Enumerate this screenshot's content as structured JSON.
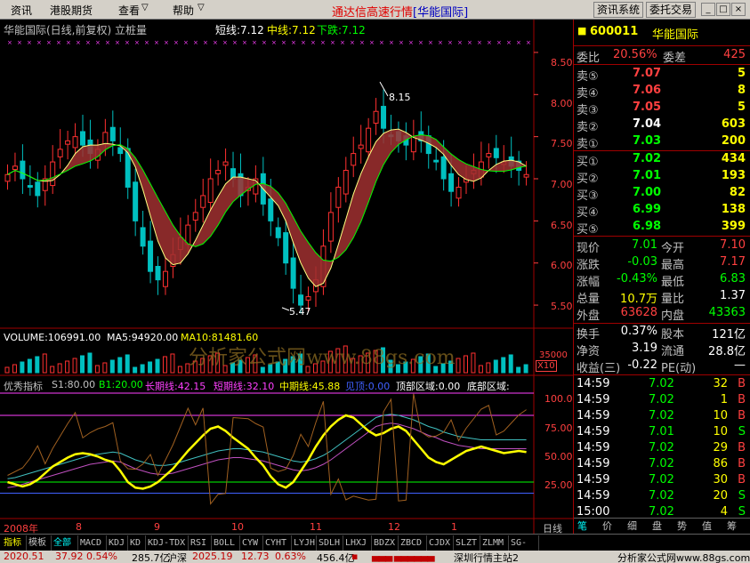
{
  "menu": {
    "items": [
      "资讯",
      "港股期货",
      "查看",
      "帮助"
    ],
    "title_main": "通达信高速行情",
    "title_sub": "[华能国际]",
    "btn_info": "资讯系统",
    "btn_trade": "委托交易",
    "win_min": "_",
    "win_max": "□",
    "win_close": "×"
  },
  "chart": {
    "header": {
      "name": "华能国际(日线,前复权)",
      "indicator": "立桩量",
      "short": "短线:7.12",
      "mid": "中线:7.12",
      "down": "下跌:7.12"
    },
    "price_ticks": [
      "8.50",
      "8.00",
      "7.50",
      "7.00",
      "6.50",
      "6.00",
      "5.50"
    ],
    "high_label": "8.15",
    "low_label": "5.47",
    "volume_header": {
      "volume": "VOLUME:106991.00",
      "ma5": "MA5:94920.00",
      "ma10": "MA10:81481.60"
    },
    "vol_tick": "35000",
    "vol_unit": "X10",
    "watermark": "分析家公式网www.88gs.com",
    "indicator_header": {
      "name": "优秀指标",
      "s1": "S1:80.00",
      "b1": "B1:20.00",
      "long": "长期线:42.15",
      "short": "短期线:32.10",
      "mid": "中期线:45.88",
      "trend": "见顶:0.00",
      "top": "顶部区域:0.00",
      "bottom": "底部区域:"
    },
    "ind_ticks": [
      "100.0",
      "75.00",
      "50.00",
      "25.00"
    ],
    "months": [
      "2008年",
      "8",
      "9",
      "10",
      "11",
      "12",
      "1"
    ],
    "period": "日线"
  },
  "chart_data": {
    "type": "candlestick",
    "title": "华能国际(日线,前复权)",
    "ylim": [
      5.3,
      8.7
    ],
    "high": 8.15,
    "low": 5.47,
    "close_series": [
      7.05,
      7.15,
      7.0,
      6.9,
      6.8,
      7.0,
      7.2,
      7.35,
      7.45,
      7.5,
      7.4,
      7.3,
      7.35,
      7.55,
      7.45,
      7.3,
      6.9,
      6.5,
      6.2,
      5.9,
      5.8,
      5.9,
      6.1,
      6.3,
      6.45,
      6.6,
      6.8,
      7.0,
      7.1,
      7.2,
      7.0,
      6.8,
      6.9,
      7.0,
      6.7,
      6.5,
      6.3,
      6.0,
      5.7,
      5.5,
      5.6,
      5.8,
      6.2,
      6.6,
      6.9,
      7.1,
      7.3,
      7.4,
      7.6,
      7.8,
      7.6,
      7.5,
      7.45,
      7.4,
      7.5,
      7.45,
      7.3,
      7.2,
      7.0,
      6.85,
      6.9,
      7.0,
      7.1,
      7.2,
      7.3,
      7.25,
      7.2,
      7.15,
      7.1,
      7.05
    ],
    "ind_series": {
      "long": [
        15,
        16,
        18,
        20,
        22,
        24,
        26,
        28,
        30,
        32,
        34,
        36,
        37,
        38,
        39,
        38,
        35,
        32,
        30,
        28,
        27,
        27,
        28,
        30,
        32,
        34,
        36,
        38,
        40,
        41,
        42,
        42,
        41,
        40,
        39,
        37,
        35,
        33,
        31,
        30,
        31,
        33,
        36,
        40,
        45,
        50,
        55,
        60,
        65,
        70,
        72,
        73,
        72,
        70,
        68,
        65,
        62,
        60,
        57,
        55,
        53,
        52,
        51,
        50,
        50,
        50,
        50,
        50,
        50,
        50
      ],
      "short": [
        20,
        18,
        16,
        18,
        22,
        28,
        34,
        38,
        42,
        45,
        46,
        45,
        43,
        40,
        38,
        30,
        20,
        15,
        14,
        16,
        20,
        26,
        32,
        40,
        48,
        55,
        62,
        68,
        70,
        66,
        60,
        55,
        50,
        42,
        35,
        25,
        18,
        15,
        20,
        30,
        40,
        52,
        62,
        70,
        76,
        80,
        78,
        72,
        66,
        62,
        64,
        68,
        70,
        66,
        58,
        50,
        42,
        38,
        36,
        40,
        44,
        48,
        50,
        52,
        50,
        48,
        46,
        47,
        48,
        47
      ]
    }
  },
  "panel": {
    "code": "600011",
    "name": "华能国际",
    "webi_label": "委比",
    "webi_val": "20.56%",
    "wecha_label": "委差",
    "wecha_val": "425",
    "sells": [
      {
        "label": "卖⑤",
        "price": "7.07",
        "vol": "5"
      },
      {
        "label": "卖④",
        "price": "7.06",
        "vol": "8"
      },
      {
        "label": "卖③",
        "price": "7.05",
        "vol": "5"
      },
      {
        "label": "卖②",
        "price": "7.04",
        "vol": "603"
      },
      {
        "label": "卖①",
        "price": "7.03",
        "vol": "200"
      }
    ],
    "buys": [
      {
        "label": "买①",
        "price": "7.02",
        "vol": "434"
      },
      {
        "label": "买②",
        "price": "7.01",
        "vol": "193"
      },
      {
        "label": "买③",
        "price": "7.00",
        "vol": "82"
      },
      {
        "label": "买④",
        "price": "6.99",
        "vol": "138"
      },
      {
        "label": "买⑤",
        "price": "6.98",
        "vol": "399"
      }
    ],
    "quote": [
      {
        "l1": "现价",
        "v1": "7.01",
        "l2": "今开",
        "v2": "7.10",
        "c1": "#00ff00",
        "c2": "#ff4040"
      },
      {
        "l1": "涨跌",
        "v1": "-0.03",
        "l2": "最高",
        "v2": "7.17",
        "c1": "#00ff00",
        "c2": "#ff4040"
      },
      {
        "l1": "涨幅",
        "v1": "-0.43%",
        "l2": "最低",
        "v2": "6.83",
        "c1": "#00ff00",
        "c2": "#00ff00"
      },
      {
        "l1": "总量",
        "v1": "10.7万",
        "l2": "量比",
        "v2": "1.37",
        "c1": "#ffff00",
        "c2": "#ffffff"
      },
      {
        "l1": "外盘",
        "v1": "63628",
        "l2": "内盘",
        "v2": "43363",
        "c1": "#ff4040",
        "c2": "#00ff00"
      }
    ],
    "fund": [
      {
        "l1": "换手",
        "v1": "0.37%",
        "l2": "股本",
        "v2": "121亿"
      },
      {
        "l1": "净资",
        "v1": "3.19",
        "l2": "流通",
        "v2": "28.8亿"
      },
      {
        "l1": "收益(三)",
        "v1": "-0.22",
        "l2": "PE(动)",
        "v2": "—"
      }
    ],
    "ticks": [
      {
        "time": "14:59",
        "price": "7.02",
        "vol": "32",
        "bs": "B"
      },
      {
        "time": "14:59",
        "price": "7.02",
        "vol": "1",
        "bs": "B"
      },
      {
        "time": "14:59",
        "price": "7.02",
        "vol": "10",
        "bs": "B"
      },
      {
        "time": "14:59",
        "price": "7.01",
        "vol": "10",
        "bs": "S"
      },
      {
        "time": "14:59",
        "price": "7.02",
        "vol": "29",
        "bs": "B"
      },
      {
        "time": "14:59",
        "price": "7.02",
        "vol": "86",
        "bs": "B"
      },
      {
        "time": "14:59",
        "price": "7.02",
        "vol": "30",
        "bs": "B"
      },
      {
        "time": "14:59",
        "price": "7.02",
        "vol": "20",
        "bs": "S"
      },
      {
        "time": "15:00",
        "price": "7.02",
        "vol": "4",
        "bs": "S"
      }
    ],
    "panel_tabs": [
      "笔",
      "价",
      "细",
      "盘",
      "势",
      "值",
      "筹"
    ]
  },
  "tabs": [
    "指标",
    "模板",
    "全部",
    "MACD",
    "KDJ",
    "KD",
    "KDJ-TDX",
    "RSI",
    "BOLL",
    "CYW",
    "CYHT",
    "LYJH",
    "SDLH",
    "LHXJ",
    "BDZX",
    "ZBCD",
    "CJDX",
    "SLZT",
    "ZLMM",
    "SG-LB"
  ],
  "status": {
    "sh": "2020.51",
    "sh_chg": "37.92",
    "sh_pct": "0.54%",
    "sh_amt": "285.7亿",
    "sz_label": "沪深",
    "sz": "2025.19",
    "sz_chg": "12.73",
    "sz_pct": "0.63%",
    "sz_amt": "456.4亿",
    "server": "深圳行情主站2",
    "site": "分析家公式网www.88gs.com"
  }
}
